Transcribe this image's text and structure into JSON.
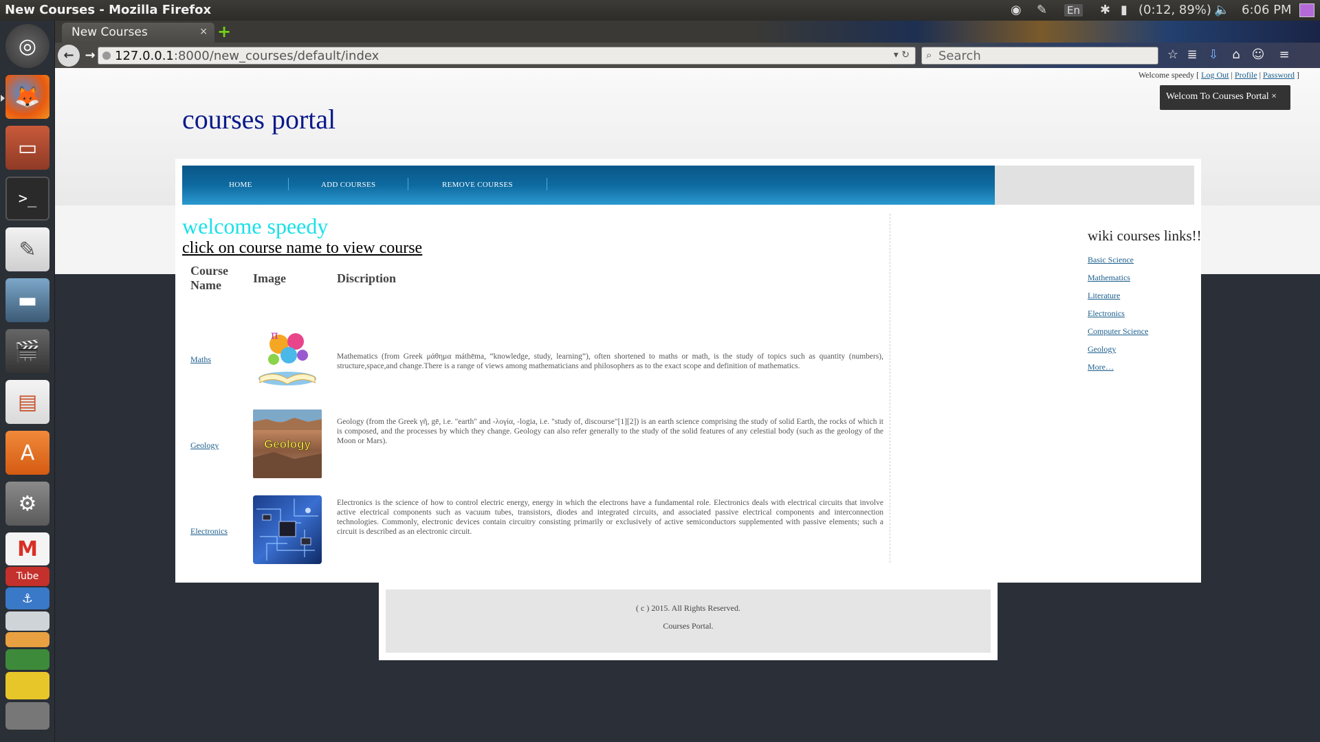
{
  "window": {
    "title": "New Courses - Mozilla Firefox"
  },
  "panel": {
    "keyboard": "En",
    "battery": "(0:12, 89%)",
    "clock": "6:06 PM"
  },
  "browser": {
    "tab_title": "New Courses",
    "tab_close": "×",
    "new_tab": "+",
    "url_host": "127.0.0.1",
    "url_path": ":8000/new_courses/default/index",
    "search_placeholder": "Search"
  },
  "page": {
    "auth": {
      "welcome": "Welcome speedy [ ",
      "logout": "Log Out",
      "sep1": " | ",
      "profile": "Profile",
      "sep2": " | ",
      "password": "Password",
      "end": " ]"
    },
    "flash": "Welcom To Courses Portal ×",
    "brand": "courses portal",
    "menu": [
      "HOME",
      "ADD COURSES",
      "REMOVE COURSES"
    ],
    "welcome_heading": "welcome speedy",
    "instructions": "click on course name to view course",
    "table": {
      "headers": {
        "name_line1": "Course",
        "name_line2": "Name",
        "image": "Image",
        "description": "Discription"
      },
      "rows": [
        {
          "name": "Maths",
          "image_label": "π",
          "description": "Mathematics (from Greek μάθημα máthēma, “knowledge, study, learning”), often shortened to maths or math, is the study of topics such as quantity (numbers), structure,space,and change.There is a range of views among mathematicians and philosophers as to the exact scope and definition of mathematics."
        },
        {
          "name": "Geology",
          "image_label": "Geology",
          "description": "Geology (from the Greek γῆ, gē, i.e. \"earth\" and -λoγία, -logia, i.e. \"study of, discourse\"[1][2]) is an earth science comprising the study of solid Earth, the rocks of which it is composed, and the processes by which they change. Geology can also refer generally to the study of the solid features of any celestial body (such as the geology of the Moon or Mars)."
        },
        {
          "name": "Electronics",
          "image_label": "",
          "description": "Electronics is the science of how to control electric energy, energy in which the electrons have a fundamental role. Electronics deals with electrical circuits that involve active electrical components such as vacuum tubes, transistors, diodes and integrated circuits, and associated passive electrical components and interconnection technologies. Commonly, electronic devices contain circuitry consisting primarily or exclusively of active semiconductors supplemented with passive elements; such a circuit is described as an electronic circuit."
        }
      ]
    },
    "sidebar": {
      "title": "wiki courses links!!",
      "links": [
        "Basic Science",
        "Mathematics",
        "Literature",
        "Electronics",
        "Computer Science",
        "Geology",
        "More…"
      ]
    },
    "footer": {
      "copyright": "( c ) 2015. All Rights Reserved.",
      "site": "Courses Portal."
    }
  },
  "colors": {
    "brand": "#0a1a8a",
    "welcome": "#19e0e8",
    "link": "#1a5d8c",
    "menubar": "#0e6aa0"
  }
}
